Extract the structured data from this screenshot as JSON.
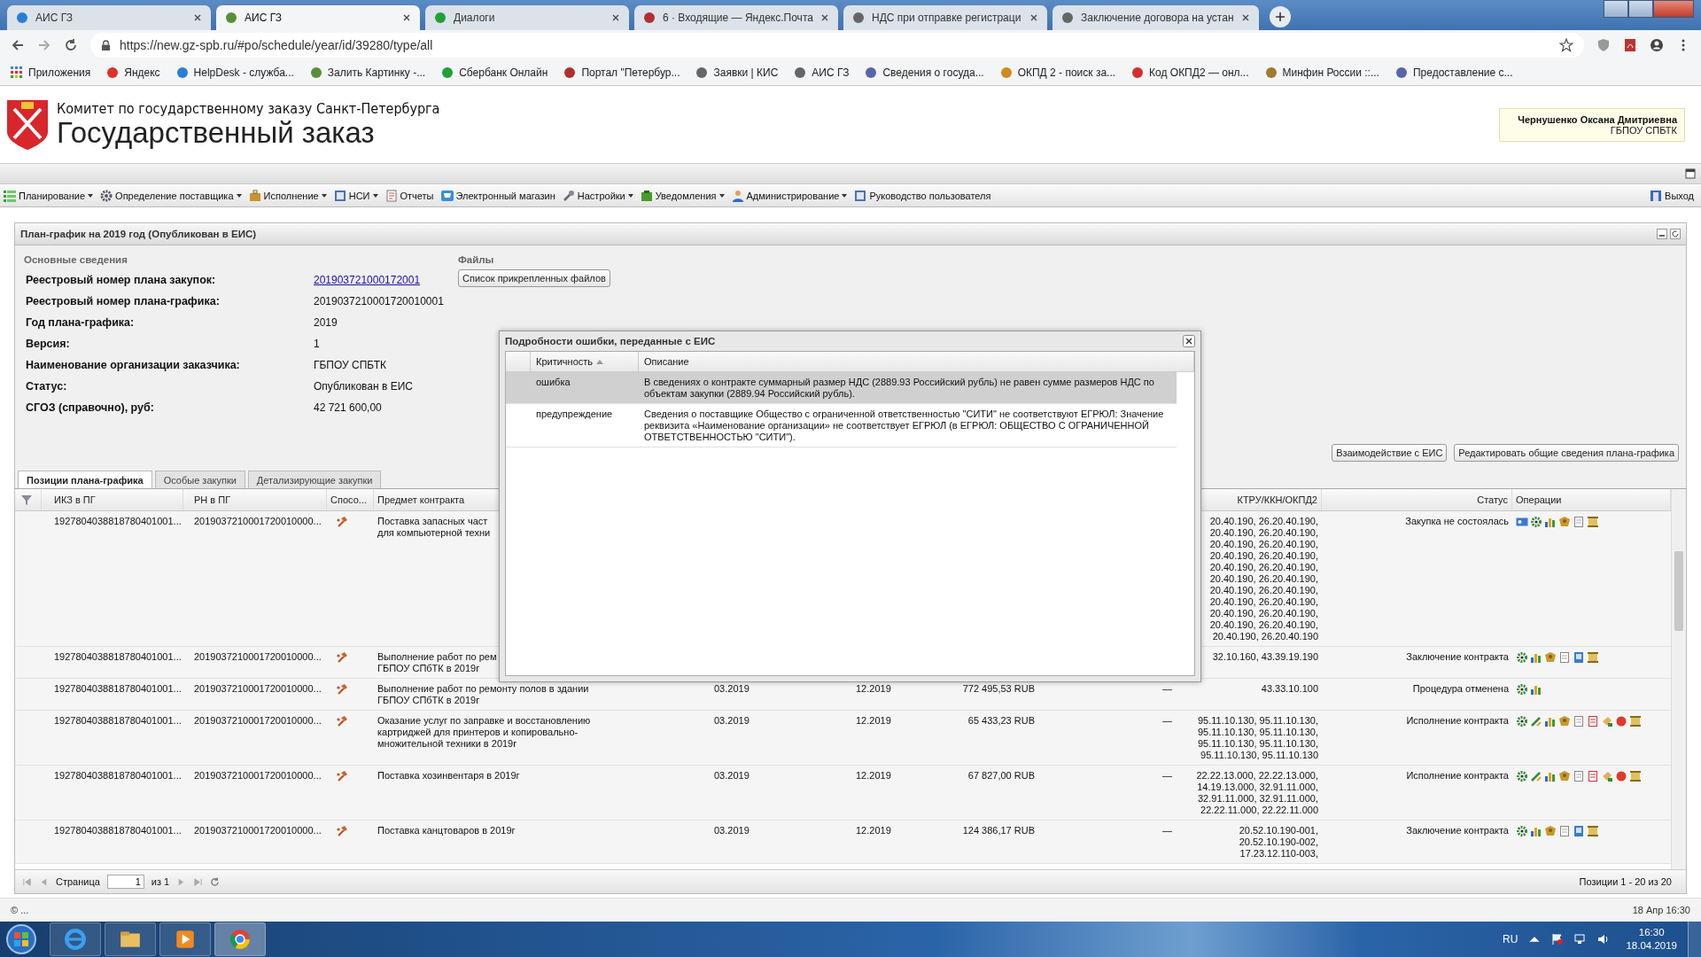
{
  "browser": {
    "tabs": [
      {
        "title": "АИС ГЗ",
        "selected": false
      },
      {
        "title": "АИС ГЗ",
        "selected": true
      },
      {
        "title": "Диалоги",
        "selected": false
      },
      {
        "title": "6 · Входящие — Яндекс.Почта",
        "selected": false
      },
      {
        "title": "НДС при отправке регистраци",
        "selected": false
      },
      {
        "title": "Заключение договора на устан",
        "selected": false
      }
    ],
    "url": "https://new.gz-spb.ru/#po/schedule/year/id/39280/type/all",
    "bookmarks": [
      "Приложения",
      "Яндекс",
      "HelpDesk - служба...",
      "Залить Картинку -...",
      "Сбербанк Онлайн",
      "Портал \"Петербур...",
      "Заявки | КИС",
      "АИС ГЗ",
      "Сведения о госуда...",
      "ОКПД 2 - поиск за...",
      "Код ОКПД2 — онл...",
      "Минфин России ::...",
      "Предоставление с..."
    ]
  },
  "header": {
    "org": "Комитет по государственному заказу Санкт-Петербурга",
    "title": "Государственный заказ",
    "user": "Чернушенко Оксана Дмитриевна",
    "user_org": "ГБПОУ СПБТК"
  },
  "menu": [
    {
      "label": "Планирование",
      "dropdown": true
    },
    {
      "label": "Определение поставщика",
      "dropdown": true
    },
    {
      "label": "Исполнение",
      "dropdown": true
    },
    {
      "label": "НСИ",
      "dropdown": true
    },
    {
      "label": "Отчеты",
      "dropdown": false
    },
    {
      "label": "Электронный магазин",
      "dropdown": false
    },
    {
      "label": "Настройки",
      "dropdown": true
    },
    {
      "label": "Уведомления",
      "dropdown": true
    },
    {
      "label": "Администрирование",
      "dropdown": true
    },
    {
      "label": "Руководство пользователя",
      "dropdown": false
    }
  ],
  "exit": "Выход",
  "panel": {
    "title": "План-график на 2019 год (Опубликован в ЕИС)",
    "section": "Основные сведения",
    "fields": [
      {
        "label": "Реестровый номер плана закупок:",
        "value": "201903721000172001",
        "link": true
      },
      {
        "label": "Реестровый номер плана-графика:",
        "value": "2019037210001720010001",
        "link": false
      },
      {
        "label": "Год плана-графика:",
        "value": "2019",
        "link": false
      },
      {
        "label": "Версия:",
        "value": "1",
        "link": false
      },
      {
        "label": "Наименование организации заказчика:",
        "value": "ГБПОУ СПБТК",
        "link": false
      },
      {
        "label": "Статус:",
        "value": "Опубликован в ЕИС",
        "link": false
      },
      {
        "label": "СГОЗ (справочно), руб:",
        "value": "42 721 600,00",
        "link": false
      }
    ],
    "files_title": "Файлы",
    "files_button": "Список прикрепленных файлов",
    "actions": [
      "Взаимодействие с ЕИС",
      "Редактировать общие сведения плана-графика"
    ],
    "tabs": [
      {
        "label": "Позиции плана-графика",
        "selected": true
      },
      {
        "label": "Особые закупки",
        "selected": false
      },
      {
        "label": "Детализирующие закупки",
        "selected": false
      }
    ],
    "columns": {
      "ikz": "ИКЗ в ПГ",
      "rn": "РН в ПГ",
      "method": "Спосо...",
      "subject": "Предмет контракта",
      "ktru": "КТРУ/ККН/ОКПД2",
      "status": "Статус",
      "operations": "Операции"
    },
    "rows": [
      {
        "ikz": "1927804038818780401001...",
        "rn": "2019037210001720010000...",
        "subject": [
          "Поставка запасных част",
          "для компьютерной техни"
        ],
        "ktru": [
          "20.40.190, 26.20.40.190,",
          "20.40.190, 26.20.40.190,",
          "20.40.190, 26.20.40.190,",
          "20.40.190, 26.20.40.190,",
          "20.40.190, 26.20.40.190,",
          "20.40.190, 26.20.40.190,",
          "20.40.190, 26.20.40.190,",
          "20.40.190, 26.20.40.190,",
          "20.40.190, 26.20.40.190,",
          "20.40.190, 26.20.40.190,",
          "20.40.190, 26.20.40.190"
        ],
        "status": "Закупка не состоялась",
        "operations": [
          {
            "kind": "card"
          },
          {
            "kind": "gear"
          },
          {
            "kind": "chart"
          },
          {
            "kind": "emblem"
          },
          {
            "kind": "doc"
          },
          {
            "kind": "scroll"
          }
        ]
      },
      {
        "ikz": "1927804038818780401001...",
        "rn": "2019037210001720010000...",
        "subject": [
          "Выполнение работ по рем",
          "ГБПОУ СПбТК в 2019г"
        ],
        "ktru": [
          "32.10.160, 43.39.19.190"
        ],
        "status": "Заключение контракта",
        "operations": [
          {
            "kind": "gear"
          },
          {
            "kind": "chart"
          },
          {
            "kind": "emblem"
          },
          {
            "kind": "doc"
          },
          {
            "kind": "bluedoc"
          },
          {
            "kind": "scroll"
          }
        ]
      },
      {
        "ikz": "1927804038818780401001...",
        "rn": "2019037210001720010000...",
        "subject": [
          "Выполнение работ по ремонту полов в здании",
          "ГБПОУ СПбТК в 2019г"
        ],
        "start": "03.2019",
        "end": "12.2019",
        "sum": "772 495,53 RUB",
        "dash": "—",
        "ktru": [
          "43.33.10.100"
        ],
        "status": "Процедура отменена",
        "operations": [
          {
            "kind": "gear"
          },
          {
            "kind": "chart"
          }
        ]
      },
      {
        "ikz": "1927804038818780401001...",
        "rn": "2019037210001720010000...",
        "subject": [
          "Оказание услуг по заправке и восстановлению",
          "картриджей для принтеров и копировально-",
          "множительной техники в 2019г"
        ],
        "start": "03.2019",
        "end": "12.2019",
        "sum": "65 433,23 RUB",
        "dash": "—",
        "ktru": [
          "95.11.10.130, 95.11.10.130,",
          "95.11.10.130, 95.11.10.130,",
          "95.11.10.130, 95.11.10.130,",
          "95.11.10.130, 95.11.10.130"
        ],
        "status": "Исполнение контракта",
        "operations": [
          {
            "kind": "gear"
          },
          {
            "kind": "pen"
          },
          {
            "kind": "chart"
          },
          {
            "kind": "emblem"
          },
          {
            "kind": "doc"
          },
          {
            "kind": "reddoc"
          },
          {
            "kind": "hand"
          },
          {
            "kind": "dot"
          },
          {
            "kind": "scroll"
          }
        ]
      },
      {
        "ikz": "1927804038818780401001...",
        "rn": "2019037210001720010000...",
        "subject": [
          "Поставка хозинвентаря в 2019г"
        ],
        "start": "03.2019",
        "end": "12.2019",
        "sum": "67 827,00 RUB",
        "dash": "—",
        "ktru": [
          "22.22.13.000, 22.22.13.000,",
          "14.19.13.000, 32.91.11.000,",
          "32.91.11.000, 32.91.11.000,",
          "22.22.11.000, 22.22.11.000"
        ],
        "status": "Исполнение контракта",
        "operations": [
          {
            "kind": "gear"
          },
          {
            "kind": "pen"
          },
          {
            "kind": "chart"
          },
          {
            "kind": "emblem"
          },
          {
            "kind": "doc"
          },
          {
            "kind": "reddoc"
          },
          {
            "kind": "hand"
          },
          {
            "kind": "dot"
          },
          {
            "kind": "scroll"
          }
        ]
      },
      {
        "ikz": "1927804038818780401001...",
        "rn": "2019037210001720010000...",
        "subject": [
          "Поставка канцтоваров в 2019г"
        ],
        "start": "03.2019",
        "end": "12.2019",
        "sum": "124 386,17 RUB",
        "dash": "—",
        "ktru": [
          "20.52.10.190-001,",
          "20.52.10.190-002,",
          "17.23.12.110-003,"
        ],
        "status": "Заключение контракта",
        "operations": [
          {
            "kind": "gear"
          },
          {
            "kind": "chart"
          },
          {
            "kind": "emblem"
          },
          {
            "kind": "doc"
          },
          {
            "kind": "bluedoc"
          },
          {
            "kind": "scroll"
          }
        ]
      }
    ],
    "pager": {
      "page_label": "Страница",
      "page": "1",
      "of": "из 1",
      "summary": "Позиции 1 - 20 из 20"
    }
  },
  "dialog": {
    "title": "Подробности ошибки, переданные с ЕИС",
    "columns": [
      "Критичность",
      "Описание"
    ],
    "rows": [
      {
        "severity": "ошибка",
        "description": "В сведениях о контракте суммарный размер НДС (2889.93 Российский рубль) не равен сумме размеров НДС по объектам закупки (2889.94 Российский рубль).",
        "selected": true
      },
      {
        "severity": "предупреждение",
        "description": "Сведения о поставщике Общество с ограниченной ответственностью \"СИТИ\" не соответствуют ЕГРЮЛ: Значение реквизита «Наименование организации» не соответствует ЕГРЮЛ (в ЕГРЮЛ: ОБЩЕСТВО С ОГРАНИЧЕННОЙ ОТВЕТСТВЕННОСТЬЮ \"СИТИ\").",
        "selected": false
      }
    ]
  },
  "status_bar": {
    "left": "© ...",
    "right": "18 Апр 16:30"
  },
  "taskbar": {
    "language": "RU",
    "time": "16:30",
    "date": "18.04.2019"
  }
}
